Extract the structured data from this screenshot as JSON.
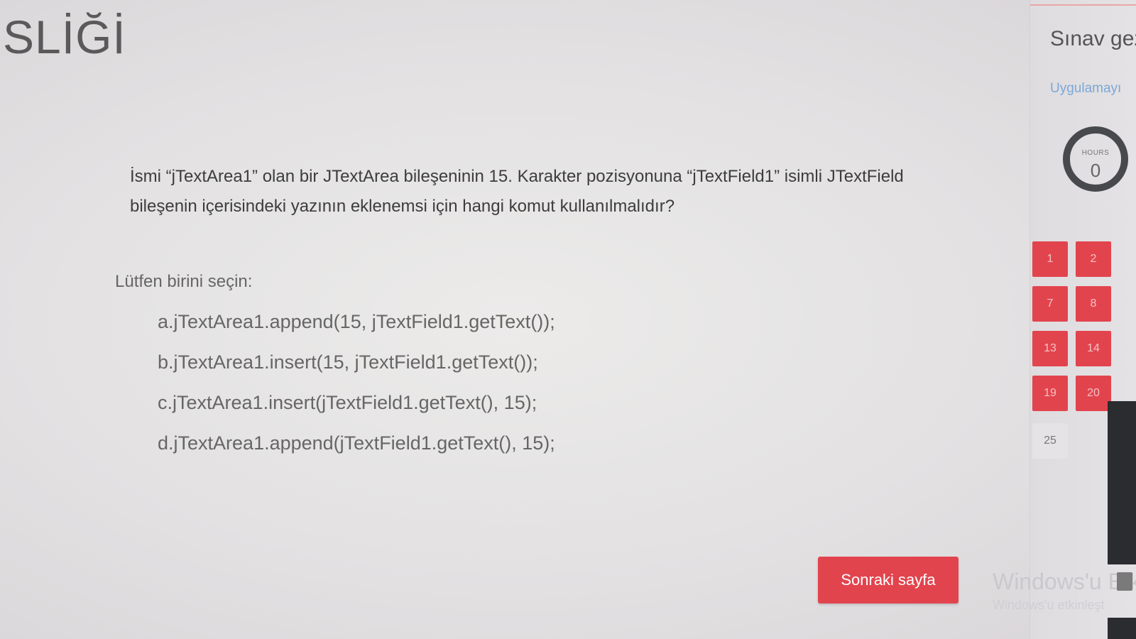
{
  "page": {
    "title": "SLİĞİ"
  },
  "question": {
    "text": "İsmi “jTextArea1” olan bir JTextArea bileşeninin 15. Karakter pozisyonuna “jTextField1” isimli JTextField bileşenin içerisindeki yazının eklenemsi için hangi komut kullanılmalıdır?",
    "prompt": "Lütfen birini seçin:",
    "options": [
      "a.jTextArea1.append(15, jTextField1.getText());",
      "b.jTextArea1.insert(15, jTextField1.getText());",
      "c.jTextArea1.insert(jTextField1.getText(), 15);",
      "d.jTextArea1.append(jTextField1.getText(), 15);"
    ]
  },
  "next_button": {
    "label": "Sonraki sayfa"
  },
  "sidebar": {
    "title": "Sınav gez",
    "link": "Uygulamayı",
    "timer": {
      "label": "HOURS",
      "value": "0"
    },
    "nav": [
      "1",
      "2",
      "7",
      "8",
      "13",
      "14",
      "19",
      "20",
      "25"
    ]
  },
  "watermark": {
    "line1": "Windows'u Etk",
    "line2": "Windows'u etkinleşt"
  },
  "colors": {
    "accent": "#e2444e",
    "link": "#79a8d8"
  }
}
